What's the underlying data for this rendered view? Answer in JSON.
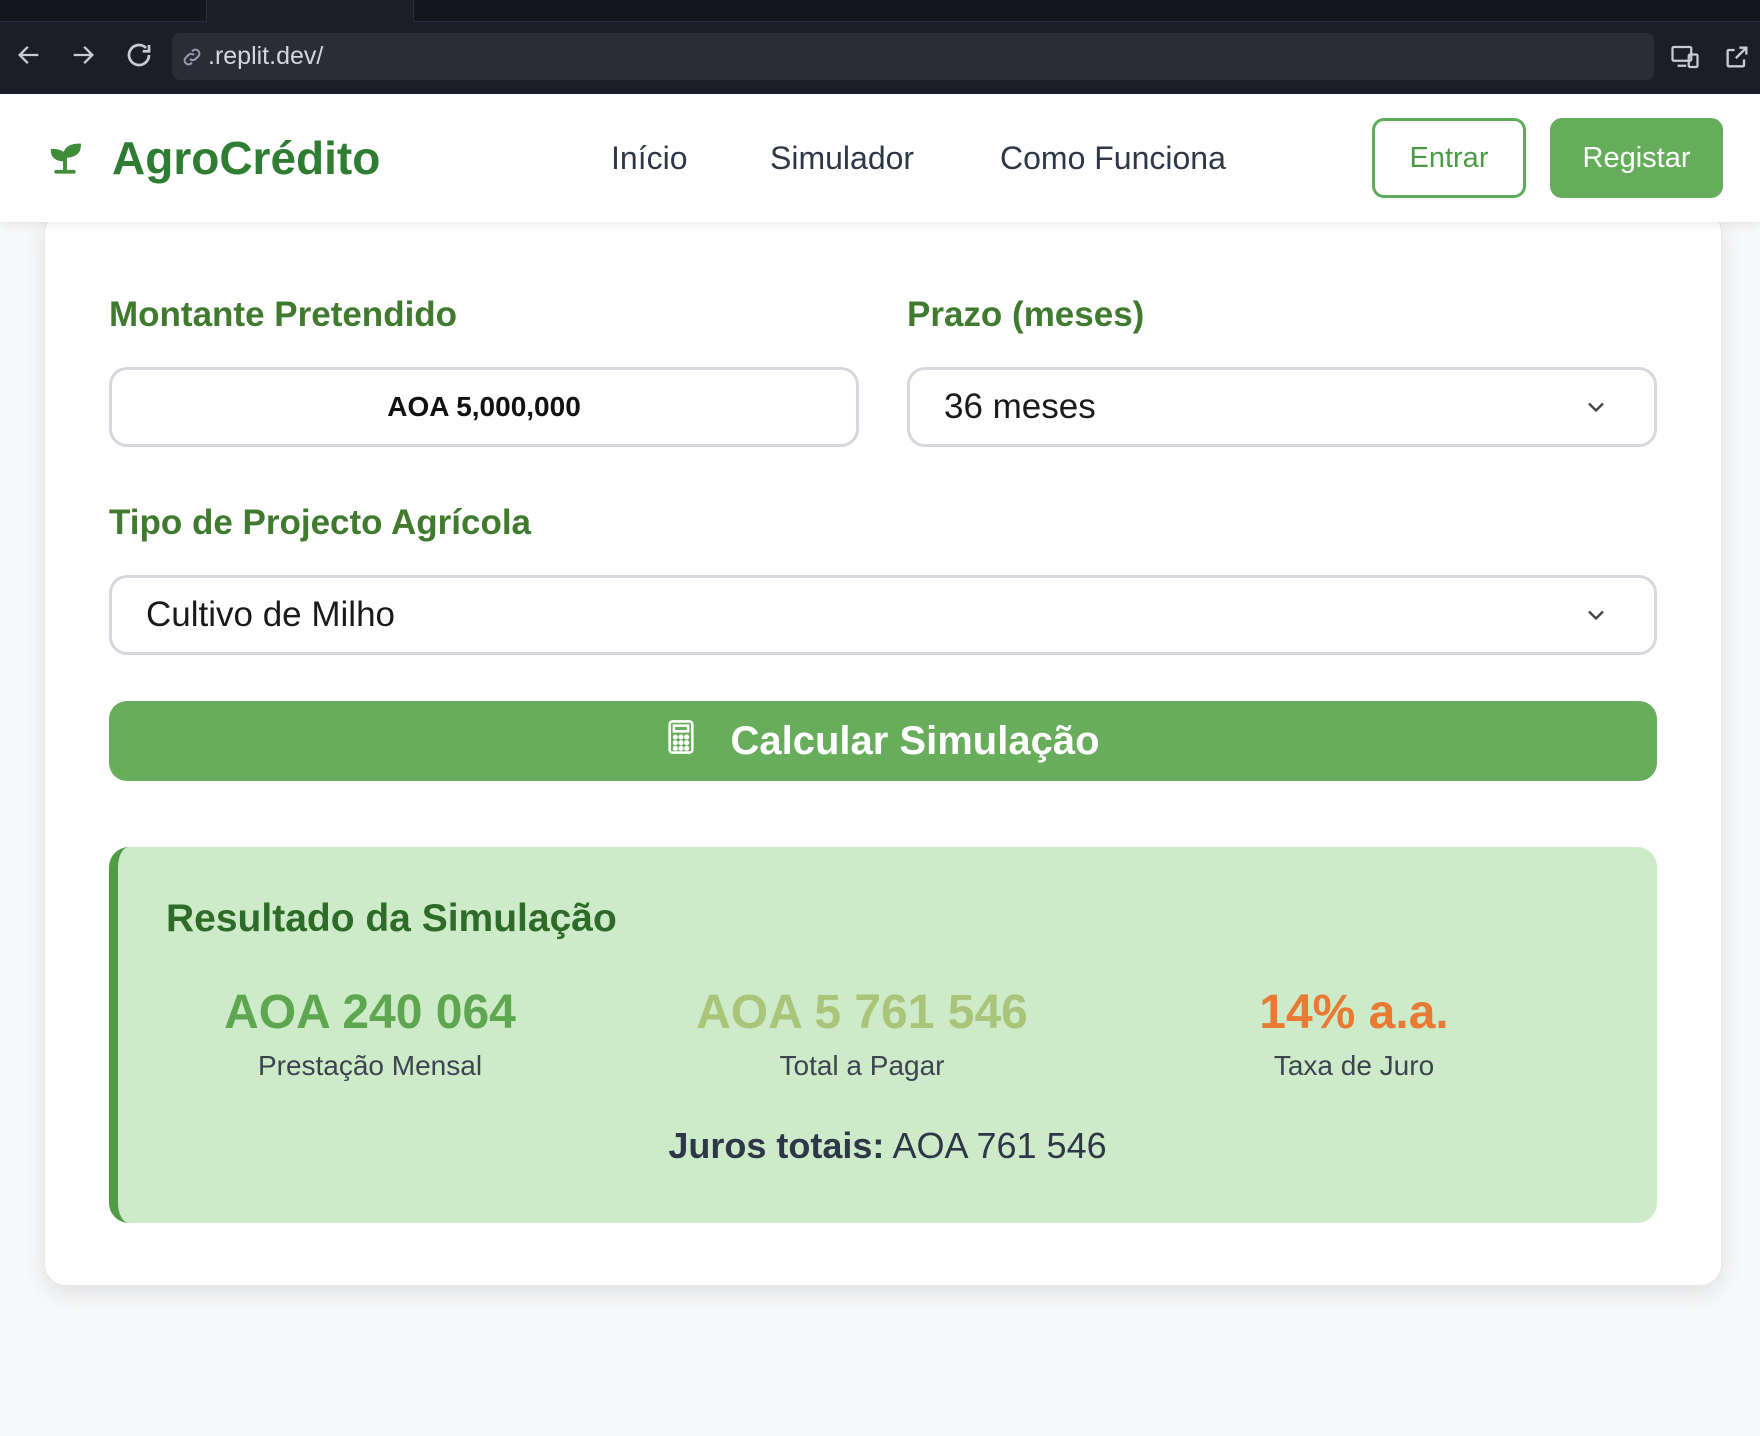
{
  "browser": {
    "url": ".replit.dev/"
  },
  "header": {
    "brand": "AgroCrédito",
    "nav": [
      "Início",
      "Simulador",
      "Como Funciona"
    ],
    "login_label": "Entrar",
    "register_label": "Registar"
  },
  "form": {
    "amount_label": "Montante Pretendido",
    "amount_value": "AOA 5,000,000",
    "term_label": "Prazo (meses)",
    "term_value": "36 meses",
    "project_label": "Tipo de Projecto Agrícola",
    "project_value": "Cultivo de Milho",
    "calculate_label": "Calcular Simulação"
  },
  "result": {
    "title": "Resultado da Simulação",
    "stats": [
      {
        "value": "AOA 240 064",
        "label": "Prestação Mensal",
        "color": "#5ea650"
      },
      {
        "value": "AOA 5 761 546",
        "label": "Total a Pagar",
        "color": "#a9c57a"
      },
      {
        "value": "14% a.a.",
        "label": "Taxa de Juro",
        "color": "#e87a33"
      }
    ],
    "interest_label": "Juros totais:",
    "interest_value": "AOA 761 546"
  },
  "colors": {
    "brand": "#2e7d32",
    "primary_button": "#68ad5b",
    "result_bg": "#cdebc8"
  }
}
